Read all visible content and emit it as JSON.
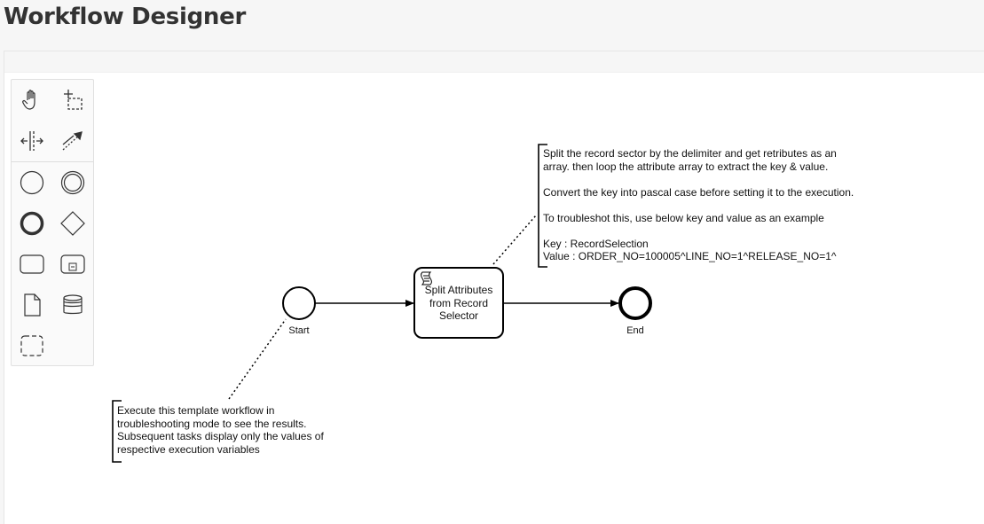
{
  "page": {
    "title": "Workflow Designer"
  },
  "palette": {
    "tools": [
      {
        "name": "hand-tool",
        "icon": "hand-icon"
      },
      {
        "name": "lasso-tool",
        "icon": "lasso-icon"
      },
      {
        "name": "space-tool",
        "icon": "space-icon"
      },
      {
        "name": "global-connect-tool",
        "icon": "connect-icon"
      },
      {
        "name": "create-start-event",
        "icon": "start-event-icon"
      },
      {
        "name": "create-intermediate-event",
        "icon": "intermediate-event-icon"
      },
      {
        "name": "create-end-event",
        "icon": "end-event-icon"
      },
      {
        "name": "create-gateway",
        "icon": "gateway-icon"
      },
      {
        "name": "create-task",
        "icon": "task-icon"
      },
      {
        "name": "create-subprocess",
        "icon": "subprocess-icon"
      },
      {
        "name": "create-data-object",
        "icon": "data-object-icon"
      },
      {
        "name": "create-data-store",
        "icon": "data-store-icon"
      },
      {
        "name": "create-group",
        "icon": "group-icon"
      }
    ]
  },
  "diagram": {
    "start_event": {
      "label": "Start"
    },
    "task": {
      "label": "Split Attributes from Record Selector",
      "icon": "script-icon"
    },
    "end_event": {
      "label": "End"
    },
    "annotation_top": {
      "text": "Split the record sector by the delimiter and get retributes as an\narray. then loop the attribute array to extract the key & value.\n\nConvert the key into pascal case before setting it to the execution.\n\nTo troubleshot this, use below key and value as an example\n\nKey : RecordSelection\nValue : ORDER_NO=100005^LINE_NO=1^RELEASE_NO=1^"
    },
    "annotation_bottom": {
      "text": "Execute this template workflow in\ntroubleshooting mode to see the results.\nSubsequent tasks display only the values of\nrespective execution variables"
    }
  }
}
